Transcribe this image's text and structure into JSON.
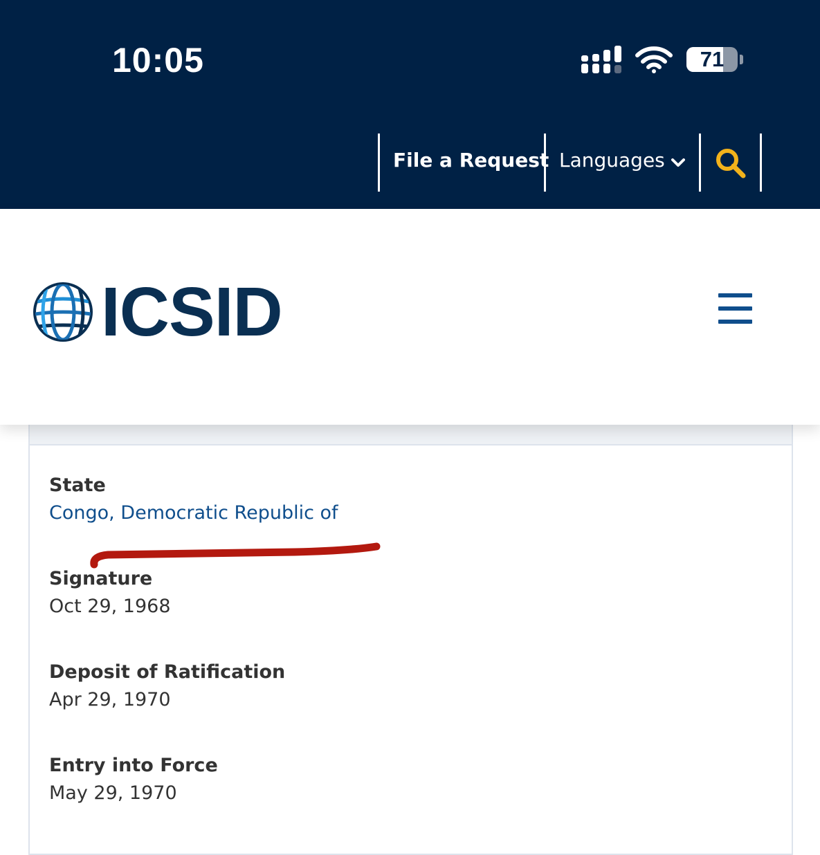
{
  "status_bar": {
    "time": "10:05",
    "battery": "71",
    "battery_level": 0.71
  },
  "utility_nav": {
    "file_request": "File a Request",
    "languages": "Languages"
  },
  "header": {
    "logo_text": "ICSID"
  },
  "record": {
    "fields": [
      {
        "label": "State",
        "value": "Congo, Democratic Republic of"
      },
      {
        "label": "Signature",
        "value": "Oct 29, 1968"
      },
      {
        "label": "Deposit of Ratification",
        "value": "Apr 29, 1970"
      },
      {
        "label": "Entry into Force",
        "value": "May 29, 1970"
      }
    ]
  },
  "colors": {
    "nav_background": "#002145",
    "search_accent": "#f2b21b",
    "link": "#0f4e8c",
    "annotation": "#b3190f"
  },
  "icons": [
    "signal-icon",
    "wifi-icon",
    "battery-icon",
    "chevron-down-icon",
    "search-icon",
    "globe-icon",
    "menu-icon"
  ]
}
